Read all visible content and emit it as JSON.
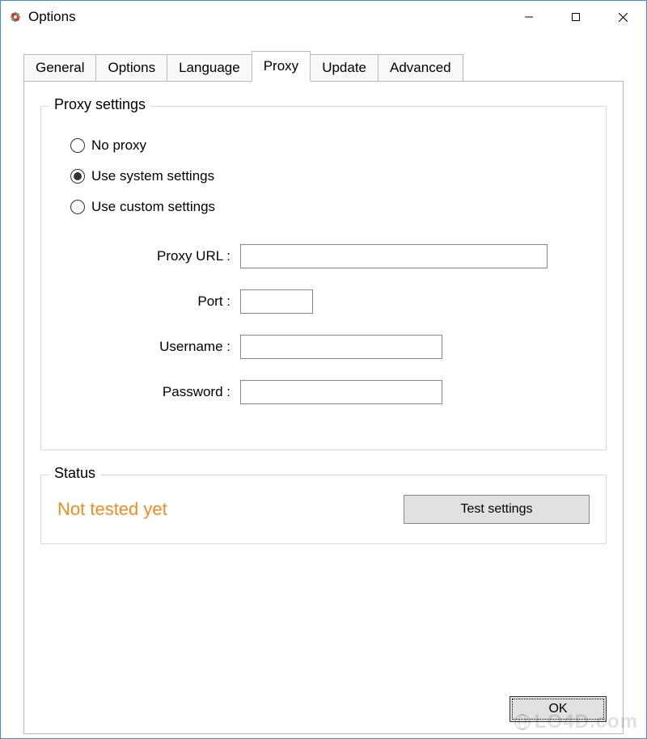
{
  "window": {
    "title": "Options"
  },
  "tabs": {
    "items": [
      {
        "label": "General"
      },
      {
        "label": "Options"
      },
      {
        "label": "Language"
      },
      {
        "label": "Proxy"
      },
      {
        "label": "Update"
      },
      {
        "label": "Advanced"
      }
    ],
    "active_index": 3
  },
  "proxy_settings": {
    "legend": "Proxy settings",
    "radios": {
      "no_proxy": "No proxy",
      "system": "Use system settings",
      "custom": "Use custom settings",
      "selected": "system"
    },
    "fields": {
      "proxy_url_label": "Proxy URL :",
      "proxy_url_value": "",
      "port_label": "Port :",
      "port_value": "",
      "username_label": "Username :",
      "username_value": "",
      "password_label": "Password :",
      "password_value": ""
    }
  },
  "status": {
    "legend": "Status",
    "text": "Not tested yet",
    "color": "#f58b1f",
    "test_button_label": "Test settings"
  },
  "buttons": {
    "ok": "OK"
  },
  "watermark": "LO4D.com"
}
